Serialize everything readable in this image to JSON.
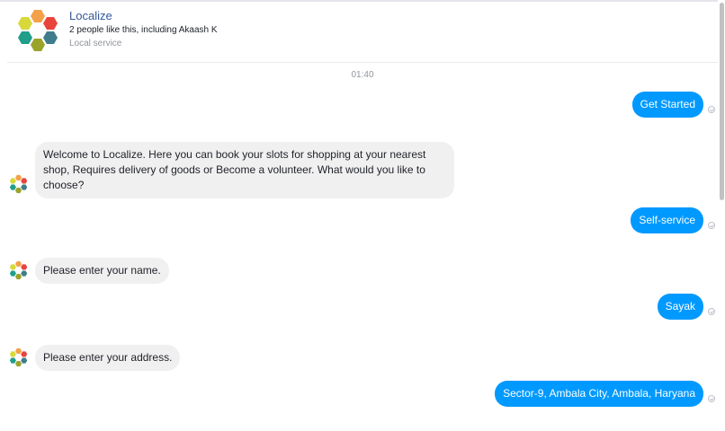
{
  "header": {
    "page_name": "Localize",
    "likes_text": "2 people like this, including Akaash K",
    "category": "Local service"
  },
  "conversation": {
    "timestamp": "01:40",
    "messages": [
      {
        "sender": "user",
        "text": "Get Started"
      },
      {
        "sender": "bot",
        "text": "Welcome to Localize. Here you can book your slots for shopping at your nearest shop, Requires delivery of goods or Become a volunteer. What would you like to choose?"
      },
      {
        "sender": "user",
        "text": "Self-service"
      },
      {
        "sender": "bot",
        "text": "Please enter your name."
      },
      {
        "sender": "user",
        "text": "Sayak"
      },
      {
        "sender": "bot",
        "text": "Please enter your address."
      },
      {
        "sender": "user",
        "text": "Sector-9, Ambala City, Ambala, Haryana"
      }
    ]
  },
  "colors": {
    "user_bubble": "#0099ff",
    "bot_bubble": "#f1f0f0",
    "page_name": "#365899"
  },
  "icons": {
    "logo": "hexagon-flower-logo-icon",
    "avatar": "hexagon-flower-avatar-icon",
    "delivered": "check-circle-icon"
  }
}
